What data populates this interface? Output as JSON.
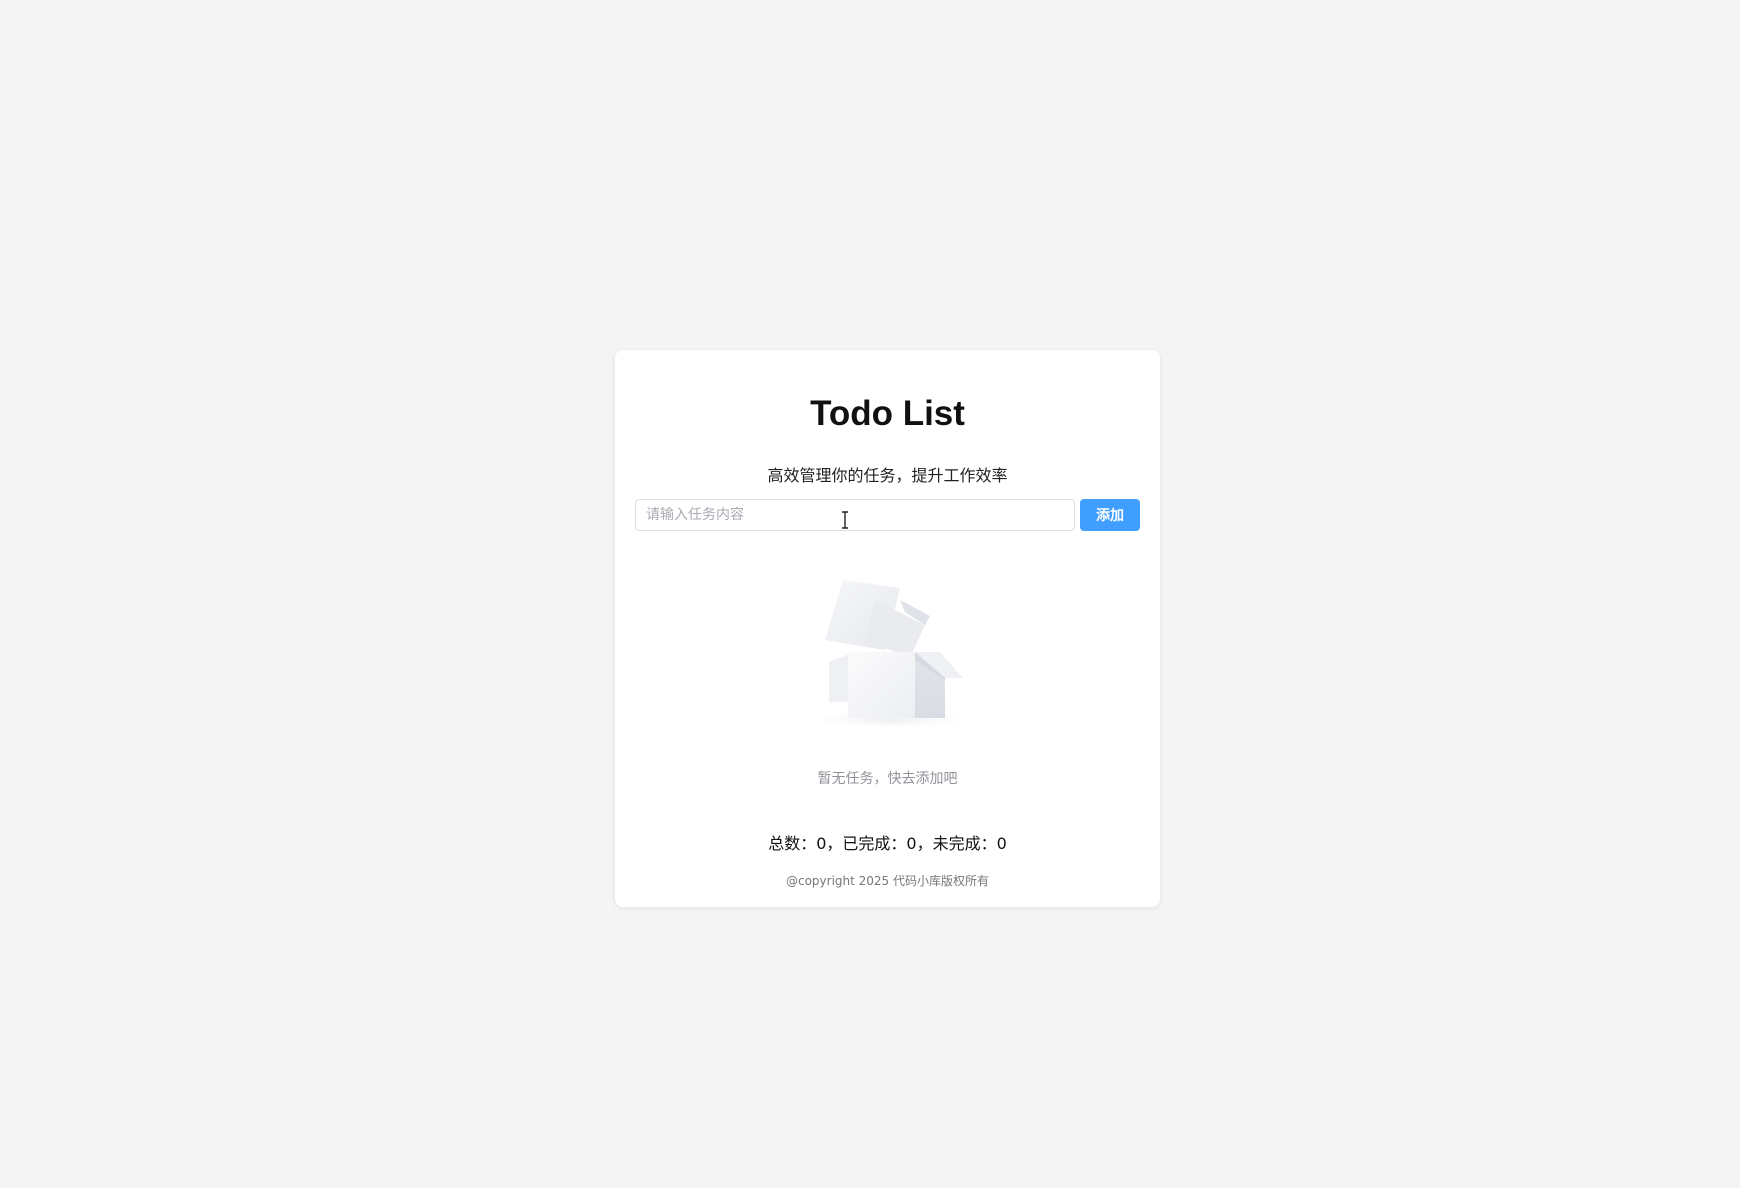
{
  "app": {
    "title": "Todo List",
    "subtitle": "高效管理你的任务，提升工作效率"
  },
  "input": {
    "placeholder": "请输入任务内容",
    "value": ""
  },
  "add_button": {
    "label": "添加",
    "color": "#409eff"
  },
  "empty": {
    "icon": "empty-box-icon",
    "text": "暂无任务，快去添加吧"
  },
  "stats": {
    "text": "总数：0，已完成：0，未完成：0"
  },
  "footer": {
    "text": "@copyright 2025 代码小库版权所有"
  },
  "cursor": {
    "icon": "text-cursor-icon"
  }
}
